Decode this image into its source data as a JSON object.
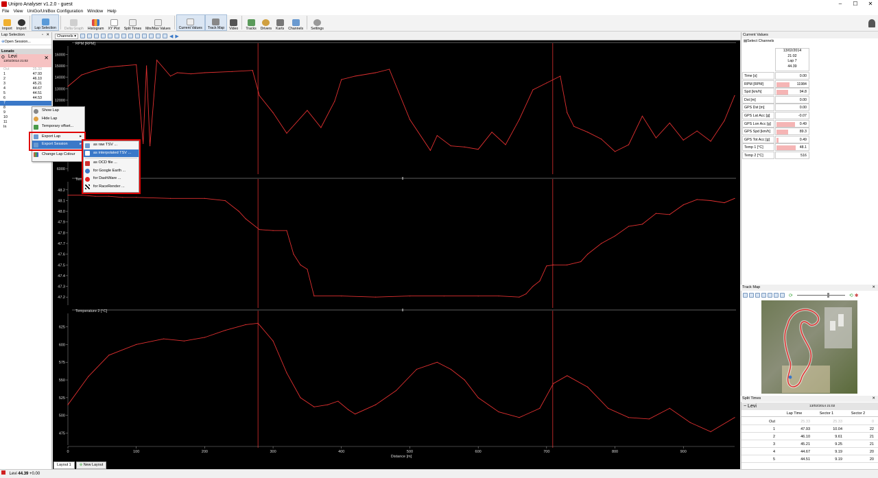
{
  "app": {
    "title": "Unipro Analyser v1.2.0 - guest"
  },
  "menu": [
    "File",
    "View",
    "UniGo/UniBox Configuration",
    "Window",
    "Help"
  ],
  "toolbar": {
    "buttons": [
      "Import",
      "Import",
      "Lap Selection",
      "Delta Graph",
      "Histogram",
      "XY Plot",
      "Split Times",
      "Min/Max Values",
      "Current Values",
      "Track Map",
      "Video",
      "Tracks",
      "Drivers",
      "Karts",
      "Channels",
      "Settings"
    ]
  },
  "lap_selection": {
    "title": "Lap Selection",
    "open_session": "Open Session...",
    "track": "Lonato",
    "session_name": "Levi",
    "session_date": "13/02/2014 21:02",
    "laps": [
      {
        "n": "Out",
        "t": "25.33"
      },
      {
        "n": "1",
        "t": "47.93"
      },
      {
        "n": "2",
        "t": "46.10"
      },
      {
        "n": "3",
        "t": "45.21"
      },
      {
        "n": "4",
        "t": "44.67"
      },
      {
        "n": "5",
        "t": "44.51"
      },
      {
        "n": "6",
        "t": "44.53"
      },
      {
        "n": "7",
        "t": ""
      },
      {
        "n": "8",
        "t": ""
      },
      {
        "n": "9",
        "t": ""
      },
      {
        "n": "10",
        "t": ""
      },
      {
        "n": "11",
        "t": ""
      },
      {
        "n": "In",
        "t": ""
      }
    ]
  },
  "context_menu": {
    "items": [
      "Show Lap",
      "Hide Lap",
      "Temporary offset...",
      "Export Lap",
      "Export Session",
      "Change Lap Colour"
    ]
  },
  "submenu": {
    "items": [
      "as raw TSV ...",
      "as interpolated TSV ...",
      "as OCD file ...",
      "for Google Earth ...",
      "for DashWare ...",
      "for RaceRender ..."
    ]
  },
  "chart_toolbar": {
    "channels_label": "Channels"
  },
  "chart_data": [
    {
      "type": "line",
      "title": "RPM [RPM]",
      "ylim": [
        6000,
        16500
      ],
      "yticks": [
        "16000",
        "15000",
        "14000",
        "13000",
        "12000",
        "11000",
        "10000",
        "9000",
        "8000",
        "7000",
        "6000"
      ],
      "x": [
        0,
        20,
        40,
        60,
        80,
        100,
        110,
        115,
        120,
        130,
        150,
        160,
        180,
        200,
        240,
        270,
        280,
        300,
        320,
        350,
        370,
        390,
        400,
        420,
        450,
        470,
        500,
        530,
        540,
        560,
        580,
        600,
        620,
        640,
        660,
        680,
        700,
        720,
        730,
        740,
        760,
        780,
        800,
        820,
        840,
        860,
        880,
        900,
        920,
        940,
        960,
        975
      ],
      "values": [
        13200,
        14200,
        14600,
        14900,
        15000,
        15100,
        8200,
        15000,
        8000,
        15500,
        14100,
        14400,
        14300,
        14400,
        14500,
        14600,
        12400,
        10900,
        9100,
        11100,
        9600,
        11900,
        13800,
        14100,
        14400,
        14700,
        10300,
        7600,
        8900,
        8000,
        7900,
        7700,
        9200,
        8100,
        10300,
        12900,
        13500,
        14100,
        10900,
        9700,
        9200,
        8600,
        7500,
        8100,
        10600,
        8700,
        10000,
        8500,
        9300,
        8400,
        10200,
        12400
      ],
      "vlines": [
        278,
        709
      ]
    },
    {
      "type": "line",
      "title": "Temperature 1 [°C]",
      "ylim": [
        47.15,
        48.25
      ],
      "yticks": [
        "48.2",
        "48.1",
        "48.0",
        "47.9",
        "47.8",
        "47.7",
        "47.6",
        "47.5",
        "47.4",
        "47.3",
        "47.2"
      ],
      "x": [
        0,
        20,
        40,
        60,
        80,
        100,
        150,
        200,
        230,
        250,
        260,
        280,
        300,
        320,
        330,
        340,
        350,
        360,
        400,
        450,
        500,
        550,
        600,
        630,
        660,
        670,
        680,
        690,
        700,
        710,
        730,
        750,
        760,
        780,
        800,
        820,
        840,
        860,
        880,
        900,
        920,
        940,
        960,
        975
      ],
      "values": [
        48.15,
        48.15,
        48.14,
        48.14,
        48.13,
        48.13,
        48.12,
        48.12,
        48.1,
        48.0,
        47.93,
        47.83,
        47.82,
        47.82,
        47.6,
        47.5,
        47.46,
        47.21,
        47.21,
        47.2,
        47.21,
        47.21,
        47.21,
        47.21,
        47.2,
        47.23,
        47.3,
        47.35,
        47.49,
        47.5,
        47.5,
        47.53,
        47.6,
        47.7,
        47.77,
        47.86,
        47.88,
        47.98,
        47.97,
        48.06,
        48.11,
        48.1,
        48.08,
        48.12
      ],
      "vlines": [
        278,
        709
      ]
    },
    {
      "type": "line",
      "title": "Temperature 2 [°C]",
      "ylim": [
        462,
        640
      ],
      "yticks": [
        "625",
        "600",
        "575",
        "550",
        "525",
        "500",
        "475"
      ],
      "xlabel": "Distance [m]",
      "xticks": [
        "0",
        "100",
        "200",
        "300",
        "400",
        "500",
        "600",
        "700",
        "800",
        "900"
      ],
      "xlim": [
        0,
        975
      ],
      "x": [
        0,
        30,
        60,
        100,
        140,
        170,
        200,
        230,
        260,
        278,
        300,
        320,
        340,
        360,
        380,
        395,
        410,
        420,
        450,
        480,
        510,
        540,
        560,
        580,
        600,
        630,
        660,
        690,
        710,
        730,
        760,
        790,
        820,
        850,
        880,
        910,
        940,
        975
      ],
      "values": [
        515,
        555,
        585,
        600,
        608,
        605,
        610,
        620,
        628,
        630,
        605,
        560,
        525,
        512,
        515,
        520,
        508,
        502,
        515,
        535,
        565,
        575,
        565,
        550,
        525,
        505,
        497,
        510,
        545,
        556,
        540,
        510,
        497,
        495,
        510,
        490,
        477,
        497
      ],
      "vlines": [
        278,
        709
      ]
    }
  ],
  "current_values": {
    "title": "Current Values",
    "select_label": "Select Channels",
    "date": "13/02/2014",
    "time": "21:02",
    "lap": "Lap 7",
    "laptime": "44.39",
    "rows": [
      {
        "label": "Time [s]",
        "value": "0.00",
        "fill": 0
      },
      {
        "label": "RPM [RPM]",
        "value": "11984",
        "fill": 0.62
      },
      {
        "label": "Spd [km/h]",
        "value": "94.8",
        "fill": 0.55
      },
      {
        "label": "Dst [m]",
        "value": "0.00",
        "fill": 0
      },
      {
        "label": "GPS Dst [m]",
        "value": "0.00",
        "fill": 0
      },
      {
        "label": "GPS Lat Acc [g]",
        "value": "-0.07",
        "fill": 0
      },
      {
        "label": "GPS Lon Acc [g]",
        "value": "0.49",
        "fill": 0.9
      },
      {
        "label": "GPS Spd [km/h]",
        "value": "89.3",
        "fill": 0.55
      },
      {
        "label": "GPS Tot Acc [g]",
        "value": "0.49",
        "fill": 0.1
      },
      {
        "label": "Temp 1 [°C]",
        "value": "48.1",
        "fill": 0.92
      },
      {
        "label": "Temp 2 [°C]",
        "value": "516",
        "fill": 0
      }
    ]
  },
  "track_map": {
    "title": "Track Map"
  },
  "split_times": {
    "title": "Split Times",
    "session": "Levi",
    "date": "13/02/2014 21:02",
    "columns": [
      "Lap Time",
      "Sector 1",
      "Sector 2"
    ],
    "rows": [
      {
        "lap": "Out",
        "t": "25.33",
        "s1": "25.33",
        "s2": "0",
        "grey": true
      },
      {
        "lap": "1",
        "t": "47.93",
        "s1": "10.04",
        "s2": "22",
        "grey": false
      },
      {
        "lap": "2",
        "t": "46.10",
        "s1": "9.61",
        "s2": "21",
        "grey": false
      },
      {
        "lap": "3",
        "t": "45.21",
        "s1": "9.25",
        "s2": "21",
        "grey": false
      },
      {
        "lap": "4",
        "t": "44.67",
        "s1": "9.19",
        "s2": "20",
        "grey": false
      },
      {
        "lap": "5",
        "t": "44.51",
        "s1": "9.19",
        "s2": "20",
        "grey": false
      }
    ]
  },
  "layout_tabs": [
    "Layout 1",
    "New Layout"
  ],
  "status": {
    "name": "Levi",
    "time": "44.39",
    "delta": "+0.00"
  },
  "colors": {
    "trace": "#e03030",
    "accent": "#3a78c8",
    "highlight": "#e00000"
  }
}
